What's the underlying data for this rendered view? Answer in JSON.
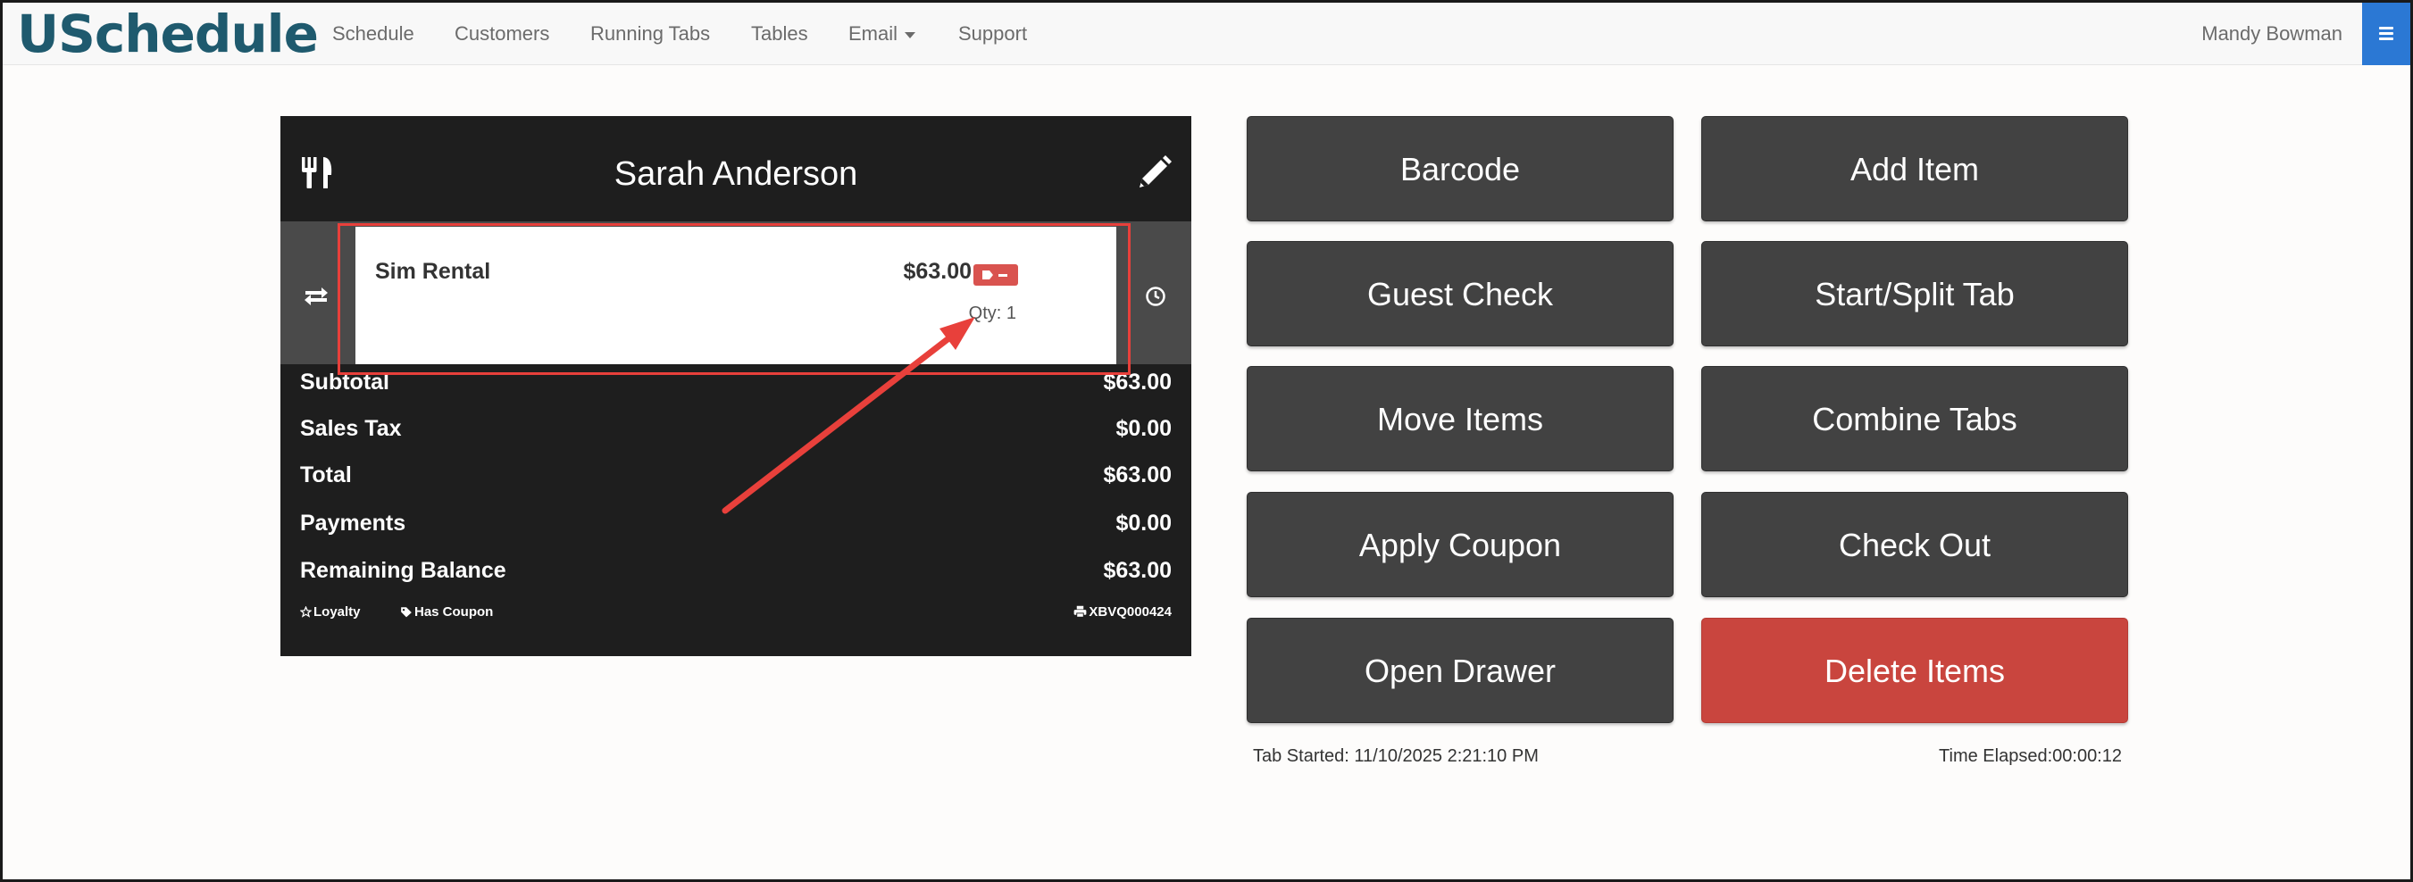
{
  "navbar": {
    "brand": "USchedule",
    "links": [
      "Schedule",
      "Customers",
      "Running Tabs",
      "Tables",
      "Email",
      "Support"
    ],
    "user": "Mandy Bowman"
  },
  "tab": {
    "customer_name": "Sarah Anderson",
    "items": [
      {
        "name": "Sim Rental",
        "price": "$63.00",
        "qty": "Qty: 1"
      }
    ],
    "totals": [
      {
        "label": "Subtotal",
        "value": "$63.00"
      },
      {
        "label": "Sales Tax",
        "value": "$0.00"
      },
      {
        "label": "Total",
        "value": "$63.00"
      },
      {
        "label": "Payments",
        "value": "$0.00"
      },
      {
        "label": "Remaining Balance",
        "value": "$63.00"
      }
    ],
    "badges": {
      "loyalty": "Loyalty",
      "coupon": "Has Coupon",
      "code": "XBVQ000424"
    }
  },
  "actions": {
    "barcode": "Barcode",
    "add_item": "Add Item",
    "guest_check": "Guest Check",
    "start_split": "Start/Split Tab",
    "move_items": "Move Items",
    "combine_tabs": "Combine Tabs",
    "apply_coupon": "Apply Coupon",
    "check_out": "Check Out",
    "open_drawer": "Open Drawer",
    "delete_items": "Delete Items"
  },
  "footer": {
    "tab_started": "Tab Started: 11/10/2025 2:21:10 PM",
    "time_elapsed": "Time Elapsed:00:00:12"
  },
  "colors": {
    "brand": "#1f5a6e",
    "panel": "#1e1e1e",
    "button": "#424242",
    "danger": "#c9453e",
    "annotation": "#e8403b",
    "menu_toggle": "#2b78d4"
  },
  "icons": [
    "fork-knife-icon",
    "pencil-icon",
    "transfer-icon",
    "clock-icon",
    "tag-icon",
    "star-icon",
    "printer-icon",
    "hamburger-icon"
  ]
}
